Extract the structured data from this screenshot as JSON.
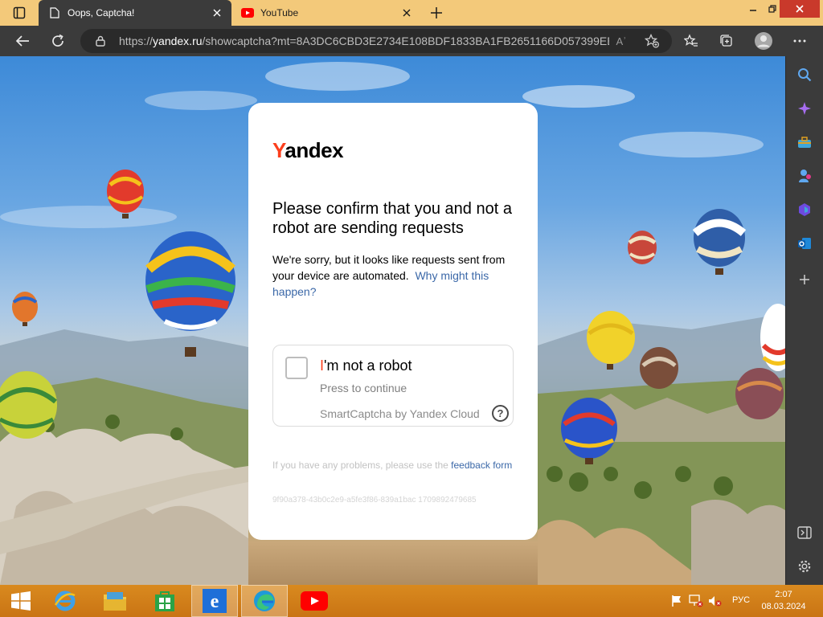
{
  "browser": {
    "tabs": [
      {
        "title": "Oops, Captcha!",
        "active": true,
        "icon": "page-icon"
      },
      {
        "title": "YouTube",
        "active": false,
        "icon": "youtube-icon"
      }
    ],
    "address": {
      "url_prefix": "https://",
      "url_domain": "yandex.ru",
      "url_rest": "/showcaptcha?mt=8A3DC6CBD3E2734E108BDF1833BA1FB2651166D057399EB...",
      "read_aloud_label": "Aʾ"
    }
  },
  "captcha_page": {
    "logo_first": "Y",
    "logo_rest": "andex",
    "heading": "Please confirm that you and not a robot are sending requests",
    "description": "We're sorry, but it looks like requests sent from your device are automated.",
    "why_link": "Why might this happen?",
    "widget": {
      "title_first": "I",
      "title_rest": "'m not a robot",
      "subtitle": "Press to continue",
      "brand": "SmartCaptcha by Yandex Cloud",
      "help": "?"
    },
    "problems_text": "If you have any problems, please use the",
    "feedback_link": "feedback form",
    "request_id": "9f90a378-43b0c2e9-a5fe3f86-839a1bac 1709892479685"
  },
  "colors": {
    "yandex_red": "#fc3f1d",
    "link_blue": "#3b68a8",
    "browser_chrome": "#3b3b3b",
    "taskbar": "#d98a1f"
  },
  "taskbar": {
    "language": "РУС",
    "time": "2:07",
    "date": "08.03.2024"
  }
}
